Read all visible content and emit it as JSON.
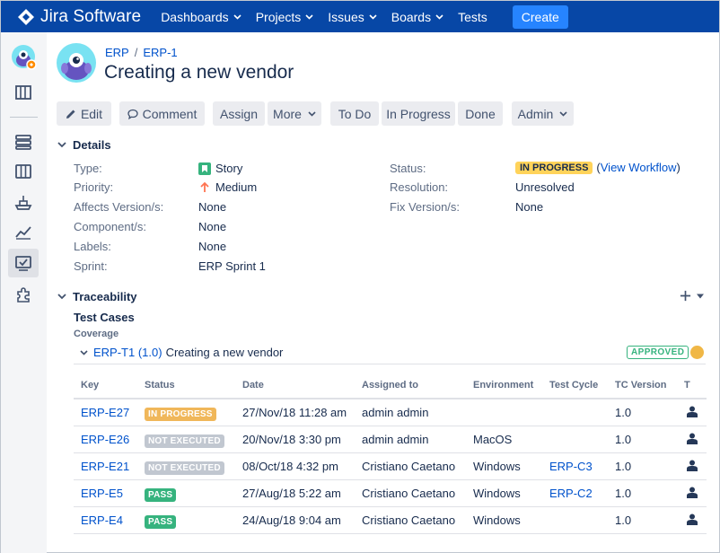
{
  "app": {
    "name": "Jira Software"
  },
  "nav": {
    "items": [
      {
        "label": "Dashboards",
        "dropdown": true
      },
      {
        "label": "Projects",
        "dropdown": true
      },
      {
        "label": "Issues",
        "dropdown": true
      },
      {
        "label": "Boards",
        "dropdown": true
      },
      {
        "label": "Tests",
        "dropdown": false
      }
    ],
    "create_label": "Create"
  },
  "colors": {
    "nav_bg": "#0747a6",
    "create_bg": "#2684ff",
    "link": "#0052cc",
    "in_progress": "#ffd35a",
    "pass": "#36b37e",
    "not_executed": "#c1c7d0",
    "approved": "#36b37e"
  },
  "sidebar": {
    "icons": [
      "project-avatar-icon",
      "board-icon",
      "backlog-icon",
      "columns-icon",
      "releases-icon",
      "reports-icon",
      "tests-icon",
      "addons-icon"
    ]
  },
  "breadcrumb": {
    "project": "ERP",
    "issue": "ERP-1"
  },
  "issue": {
    "title": "Creating a new vendor"
  },
  "toolbar": {
    "edit": "Edit",
    "comment": "Comment",
    "assign": "Assign",
    "more": "More",
    "todo": "To Do",
    "in_progress": "In Progress",
    "done": "Done",
    "admin": "Admin"
  },
  "details": {
    "title": "Details",
    "left": [
      {
        "label": "Type:",
        "value": "Story",
        "icon": "story-icon"
      },
      {
        "label": "Priority:",
        "value": "Medium",
        "icon": "priority-medium-icon"
      },
      {
        "label": "Affects Version/s:",
        "value": "None"
      },
      {
        "label": "Component/s:",
        "value": "None"
      },
      {
        "label": "Labels:",
        "value": "None"
      },
      {
        "label": "Sprint:",
        "value": "ERP Sprint 1"
      }
    ],
    "right": {
      "status_label": "Status:",
      "status_value": "IN PROGRESS",
      "view_workflow_open": "(",
      "view_workflow": "View Workflow",
      "view_workflow_close": ")",
      "resolution_label": "Resolution:",
      "resolution_value": "Unresolved",
      "fix_label": "Fix Version/s:",
      "fix_value": "None"
    }
  },
  "traceability": {
    "title": "Traceability",
    "test_cases_title": "Test Cases",
    "coverage_label": "Coverage",
    "test_case": {
      "key": "ERP-T1 (1.0)",
      "name": "Creating a new vendor",
      "status": "APPROVED"
    },
    "columns": [
      "Key",
      "Status",
      "Date",
      "Assigned to",
      "Environment",
      "Test Cycle",
      "TC Version",
      "T"
    ],
    "rows": [
      {
        "key": "ERP-E27",
        "status": "IN PROGRESS",
        "status_type": "inprog",
        "date": "27/Nov/18 11:28 am",
        "assigned": "admin admin",
        "env": "",
        "cycle": "",
        "version": "1.0"
      },
      {
        "key": "ERP-E26",
        "status": "NOT EXECUTED",
        "status_type": "notexec",
        "date": "20/Nov/18 3:30 pm",
        "assigned": "admin admin",
        "env": "MacOS",
        "cycle": "",
        "version": "1.0"
      },
      {
        "key": "ERP-E21",
        "status": "NOT EXECUTED",
        "status_type": "notexec",
        "date": "08/Oct/18 4:32 pm",
        "assigned": "Cristiano Caetano",
        "env": "Windows",
        "cycle": "ERP-C3",
        "version": "1.0"
      },
      {
        "key": "ERP-E5",
        "status": "PASS",
        "status_type": "pass",
        "date": "27/Aug/18 5:22 am",
        "assigned": "Cristiano Caetano",
        "env": "Windows",
        "cycle": "ERP-C2",
        "version": "1.0"
      },
      {
        "key": "ERP-E4",
        "status": "PASS",
        "status_type": "pass",
        "date": "24/Aug/18 9:04 am",
        "assigned": "Cristiano Caetano",
        "env": "Windows",
        "cycle": "",
        "version": "1.0"
      }
    ]
  }
}
